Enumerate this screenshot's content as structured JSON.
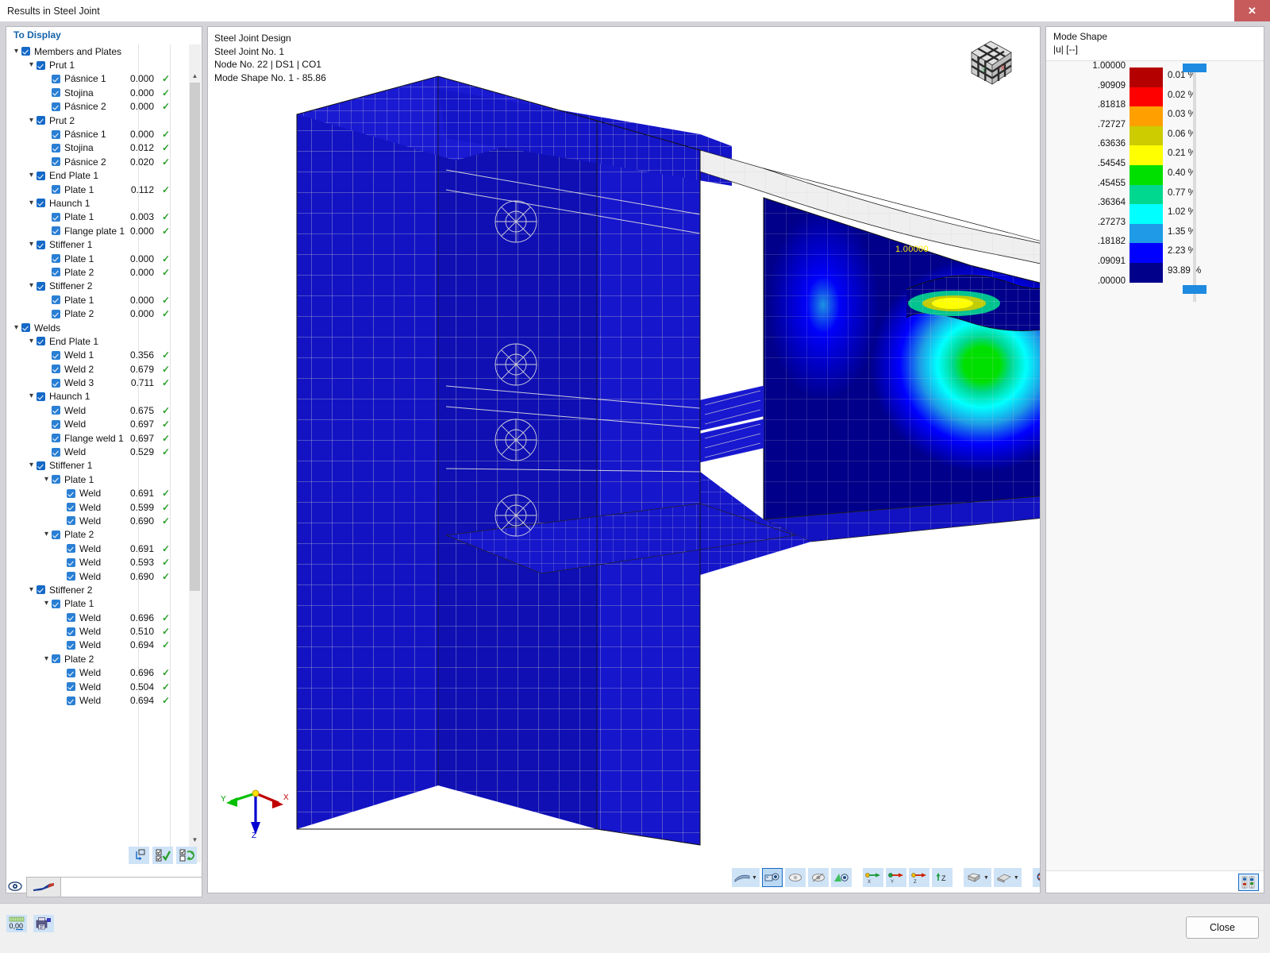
{
  "window": {
    "title": "Results in Steel Joint",
    "close_icon": "close-icon",
    "close_glyph": "✕"
  },
  "left_panel": {
    "header": "To Display",
    "tree": [
      {
        "depth": 0,
        "chev": true,
        "label": "Members and Plates",
        "value": "",
        "check": false
      },
      {
        "depth": 1,
        "chev": true,
        "label": "Prut 1",
        "value": "",
        "check": false
      },
      {
        "depth": 2,
        "chev": false,
        "label": "Pásnice 1",
        "value": "0.000",
        "check": true
      },
      {
        "depth": 2,
        "chev": false,
        "label": "Stojina",
        "value": "0.000",
        "check": true
      },
      {
        "depth": 2,
        "chev": false,
        "label": "Pásnice 2",
        "value": "0.000",
        "check": true
      },
      {
        "depth": 1,
        "chev": true,
        "label": "Prut 2",
        "value": "",
        "check": false
      },
      {
        "depth": 2,
        "chev": false,
        "label": "Pásnice 1",
        "value": "0.000",
        "check": true
      },
      {
        "depth": 2,
        "chev": false,
        "label": "Stojina",
        "value": "0.012",
        "check": true
      },
      {
        "depth": 2,
        "chev": false,
        "label": "Pásnice 2",
        "value": "0.020",
        "check": true
      },
      {
        "depth": 1,
        "chev": true,
        "label": "End Plate 1",
        "value": "",
        "check": false
      },
      {
        "depth": 2,
        "chev": false,
        "label": "Plate 1",
        "value": "0.112",
        "check": true
      },
      {
        "depth": 1,
        "chev": true,
        "label": "Haunch 1",
        "value": "",
        "check": false
      },
      {
        "depth": 2,
        "chev": false,
        "label": "Plate 1",
        "value": "0.003",
        "check": true
      },
      {
        "depth": 2,
        "chev": false,
        "label": "Flange plate 1",
        "value": "0.000",
        "check": true
      },
      {
        "depth": 1,
        "chev": true,
        "label": "Stiffener 1",
        "value": "",
        "check": false
      },
      {
        "depth": 2,
        "chev": false,
        "label": "Plate 1",
        "value": "0.000",
        "check": true
      },
      {
        "depth": 2,
        "chev": false,
        "label": "Plate 2",
        "value": "0.000",
        "check": true
      },
      {
        "depth": 1,
        "chev": true,
        "label": "Stiffener 2",
        "value": "",
        "check": false
      },
      {
        "depth": 2,
        "chev": false,
        "label": "Plate 1",
        "value": "0.000",
        "check": true
      },
      {
        "depth": 2,
        "chev": false,
        "label": "Plate 2",
        "value": "0.000",
        "check": true
      },
      {
        "depth": 0,
        "chev": true,
        "label": "Welds",
        "value": "",
        "check": false
      },
      {
        "depth": 1,
        "chev": true,
        "label": "End Plate 1",
        "value": "",
        "check": false
      },
      {
        "depth": 2,
        "chev": false,
        "label": "Weld 1",
        "value": "0.356",
        "check": true
      },
      {
        "depth": 2,
        "chev": false,
        "label": "Weld 2",
        "value": "0.679",
        "check": true
      },
      {
        "depth": 2,
        "chev": false,
        "label": "Weld 3",
        "value": "0.711",
        "check": true
      },
      {
        "depth": 1,
        "chev": true,
        "label": "Haunch 1",
        "value": "",
        "check": false
      },
      {
        "depth": 2,
        "chev": false,
        "label": "Weld",
        "value": "0.675",
        "check": true
      },
      {
        "depth": 2,
        "chev": false,
        "label": "Weld",
        "value": "0.697",
        "check": true
      },
      {
        "depth": 2,
        "chev": false,
        "label": "Flange weld 1",
        "value": "0.697",
        "check": true
      },
      {
        "depth": 2,
        "chev": false,
        "label": "Weld",
        "value": "0.529",
        "check": true
      },
      {
        "depth": 1,
        "chev": true,
        "label": "Stiffener 1",
        "value": "",
        "check": false
      },
      {
        "depth": 2,
        "chev": true,
        "label": "Plate 1",
        "value": "",
        "check": false
      },
      {
        "depth": 3,
        "chev": false,
        "label": "Weld",
        "value": "0.691",
        "check": true
      },
      {
        "depth": 3,
        "chev": false,
        "label": "Weld",
        "value": "0.599",
        "check": true
      },
      {
        "depth": 3,
        "chev": false,
        "label": "Weld",
        "value": "0.690",
        "check": true
      },
      {
        "depth": 2,
        "chev": true,
        "label": "Plate 2",
        "value": "",
        "check": false
      },
      {
        "depth": 3,
        "chev": false,
        "label": "Weld",
        "value": "0.691",
        "check": true
      },
      {
        "depth": 3,
        "chev": false,
        "label": "Weld",
        "value": "0.593",
        "check": true
      },
      {
        "depth": 3,
        "chev": false,
        "label": "Weld",
        "value": "0.690",
        "check": true
      },
      {
        "depth": 1,
        "chev": true,
        "label": "Stiffener 2",
        "value": "",
        "check": false
      },
      {
        "depth": 2,
        "chev": true,
        "label": "Plate 1",
        "value": "",
        "check": false
      },
      {
        "depth": 3,
        "chev": false,
        "label": "Weld",
        "value": "0.696",
        "check": true
      },
      {
        "depth": 3,
        "chev": false,
        "label": "Weld",
        "value": "0.510",
        "check": true
      },
      {
        "depth": 3,
        "chev": false,
        "label": "Weld",
        "value": "0.694",
        "check": true
      },
      {
        "depth": 2,
        "chev": true,
        "label": "Plate 2",
        "value": "",
        "check": false
      },
      {
        "depth": 3,
        "chev": false,
        "label": "Weld",
        "value": "0.696",
        "check": true
      },
      {
        "depth": 3,
        "chev": false,
        "label": "Weld",
        "value": "0.504",
        "check": true
      },
      {
        "depth": 3,
        "chev": false,
        "label": "Weld",
        "value": "0.694",
        "check": true
      }
    ],
    "bottom_tools": [
      {
        "name": "reset-selection-button"
      },
      {
        "name": "select-all-button"
      },
      {
        "name": "invert-selection-button"
      }
    ],
    "foot": {
      "eye_icon": "visibility-eye-icon",
      "tile_icon": "result-diagram-icon"
    }
  },
  "viewport": {
    "header_lines": [
      "Steel Joint Design",
      "Steel Joint No. 1",
      "Node No. 22 | DS1 | CO1",
      "Mode Shape No. 1 - 85.86"
    ],
    "max_value_label": "1.00000",
    "axes": {
      "x": "X",
      "y": "Y",
      "z": "Z"
    },
    "navcube": {
      "left_face": "-Y",
      "right_face": "-X"
    },
    "toolbar": [
      {
        "name": "render-mode-dropdown",
        "icon": "shading-icon",
        "dropdown": true,
        "selected": false
      },
      {
        "name": "display-surfaces-button",
        "icon": "solid-view-icon",
        "dropdown": false,
        "selected": true
      },
      {
        "name": "display-wireframe-button",
        "icon": "wireframe-view-icon",
        "dropdown": false,
        "selected": false
      },
      {
        "name": "display-transparent-button",
        "icon": "transparent-view-icon",
        "dropdown": false,
        "selected": false
      },
      {
        "name": "display-section-button",
        "icon": "section-view-icon",
        "dropdown": false,
        "selected": false
      },
      {
        "name": "view-in-x-button",
        "icon": "axis-x-icon",
        "dropdown": false,
        "selected": false
      },
      {
        "name": "view-in-y-button",
        "icon": "axis-y-icon",
        "dropdown": false,
        "selected": false
      },
      {
        "name": "view-in-z-button",
        "icon": "axis-z-icon",
        "dropdown": false,
        "selected": false
      },
      {
        "name": "view-z-axis-button",
        "icon": "axis-z-label-icon",
        "dropdown": false,
        "selected": false
      },
      {
        "name": "projection-mode-dropdown",
        "icon": "box-projection-icon",
        "dropdown": true,
        "selected": false
      },
      {
        "name": "perspective-mode-dropdown",
        "icon": "perspective-icon",
        "dropdown": true,
        "selected": false
      },
      {
        "name": "zoom-reset-button",
        "icon": "zoom-all-icon",
        "dropdown": false,
        "selected": false
      }
    ]
  },
  "legend": {
    "title": "Mode Shape",
    "subtitle": "|u| [--]",
    "config_button": "legend-settings-icon",
    "chart_data": {
      "type": "heatmap",
      "title": "Mode Shape |u| [--]",
      "ticks": [
        "1.00000",
        ".90909",
        ".81818",
        ".72727",
        ".63636",
        ".54545",
        ".45455",
        ".36364",
        ".27273",
        ".18182",
        ".09091",
        ".00000"
      ],
      "bands": [
        {
          "color": "#b50000",
          "percent": "0.01 %"
        },
        {
          "color": "#ff0000",
          "percent": "0.02 %"
        },
        {
          "color": "#ffa000",
          "percent": "0.03 %"
        },
        {
          "color": "#cccc00",
          "percent": "0.06 %"
        },
        {
          "color": "#ffff00",
          "percent": "0.21 %"
        },
        {
          "color": "#00e000",
          "percent": "0.40 %"
        },
        {
          "color": "#00d890",
          "percent": "0.77 %"
        },
        {
          "color": "#00ffff",
          "percent": "1.02 %"
        },
        {
          "color": "#1e9ae6",
          "percent": "1.35 %"
        },
        {
          "color": "#0000ff",
          "percent": "2.23 %"
        },
        {
          "color": "#00008b",
          "percent": "93.89 %"
        }
      ],
      "ylim": [
        0,
        1
      ],
      "slider_color": "#1e8ae0"
    }
  },
  "footer": {
    "tools": [
      {
        "name": "decimal-places-button",
        "icon": "number-format-icon"
      },
      {
        "name": "print-report-button",
        "icon": "printer-icon"
      }
    ],
    "close_label": "Close"
  }
}
